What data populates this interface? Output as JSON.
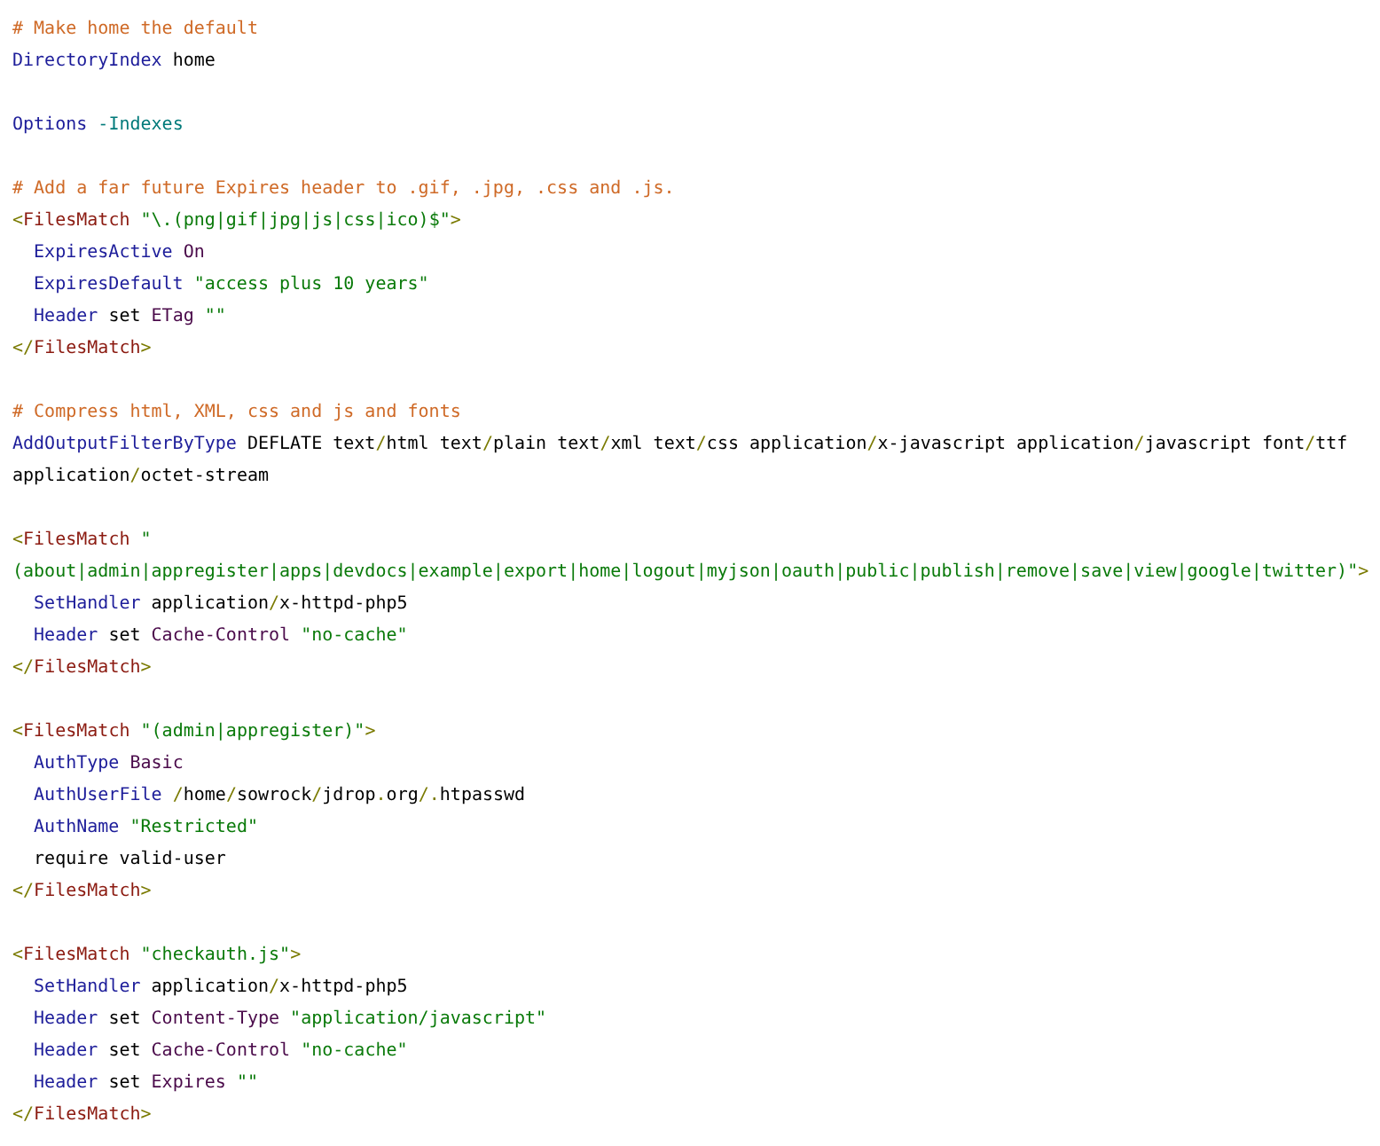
{
  "code_blocks": [
    {
      "lines": [
        [
          {
            "text": "# Make home the default",
            "kind": "comment"
          }
        ],
        [
          {
            "text": "DirectoryIndex",
            "kind": "directive"
          },
          {
            "text": " home",
            "kind": "plain"
          }
        ]
      ]
    },
    {
      "lines": [
        [
          {
            "text": "Options",
            "kind": "directive"
          },
          {
            "text": " -Indexes",
            "kind": "value"
          }
        ]
      ]
    },
    {
      "lines": [
        [
          {
            "text": "# Add a far future Expires header to .gif, .jpg, .css and .js.",
            "kind": "comment"
          }
        ],
        [
          {
            "text": "<",
            "kind": "punct"
          },
          {
            "text": "FilesMatch",
            "kind": "tag"
          },
          {
            "text": " \"\\.(png|gif|jpg|js|css|ico)$\"",
            "kind": "string"
          },
          {
            "text": ">",
            "kind": "punct"
          }
        ],
        [
          {
            "text": "  ExpiresActive",
            "kind": "directive"
          },
          {
            "text": " On",
            "kind": "attr"
          }
        ],
        [
          {
            "text": "  ExpiresDefault",
            "kind": "directive"
          },
          {
            "text": " \"access plus 10 years\"",
            "kind": "string"
          }
        ],
        [
          {
            "text": "  Header",
            "kind": "directive"
          },
          {
            "text": " set ",
            "kind": "plain"
          },
          {
            "text": "ETag",
            "kind": "attr"
          },
          {
            "text": " \"\"",
            "kind": "string"
          }
        ],
        [
          {
            "text": "</",
            "kind": "punct"
          },
          {
            "text": "FilesMatch",
            "kind": "tag"
          },
          {
            "text": ">",
            "kind": "punct"
          }
        ]
      ]
    },
    {
      "lines": [
        [
          {
            "text": "# Compress html, XML, css and js and fonts",
            "kind": "comment"
          }
        ],
        [
          {
            "text": "AddOutputFilterByType",
            "kind": "directive"
          },
          {
            "text": " DEFLATE text",
            "kind": "plain"
          },
          {
            "text": "/",
            "kind": "punct"
          },
          {
            "text": "html text",
            "kind": "plain"
          },
          {
            "text": "/",
            "kind": "punct"
          },
          {
            "text": "plain text",
            "kind": "plain"
          },
          {
            "text": "/",
            "kind": "punct"
          },
          {
            "text": "xml text",
            "kind": "plain"
          },
          {
            "text": "/",
            "kind": "punct"
          },
          {
            "text": "css application",
            "kind": "plain"
          },
          {
            "text": "/",
            "kind": "punct"
          },
          {
            "text": "x-javascript application",
            "kind": "plain"
          },
          {
            "text": "/",
            "kind": "punct"
          },
          {
            "text": "javascript font",
            "kind": "plain"
          },
          {
            "text": "/",
            "kind": "punct"
          },
          {
            "text": "ttf",
            "kind": "plain"
          }
        ],
        [
          {
            "text": "application",
            "kind": "plain"
          },
          {
            "text": "/",
            "kind": "punct"
          },
          {
            "text": "octet-stream",
            "kind": "plain"
          }
        ]
      ]
    },
    {
      "lines": [
        [
          {
            "text": "<",
            "kind": "punct"
          },
          {
            "text": "FilesMatch",
            "kind": "tag"
          },
          {
            "text": " \"",
            "kind": "string"
          }
        ],
        [
          {
            "text": "(about|admin|appregister|apps|devdocs|example|export|home|logout|myjson|oauth|public|publish|remove|save|view|google|twitter)\"",
            "kind": "string"
          },
          {
            "text": ">",
            "kind": "punct"
          }
        ],
        [
          {
            "text": "  SetHandler",
            "kind": "directive"
          },
          {
            "text": " application",
            "kind": "plain"
          },
          {
            "text": "/",
            "kind": "punct"
          },
          {
            "text": "x-httpd-php5",
            "kind": "plain"
          }
        ],
        [
          {
            "text": "  Header",
            "kind": "directive"
          },
          {
            "text": " set ",
            "kind": "plain"
          },
          {
            "text": "Cache-Control",
            "kind": "attr"
          },
          {
            "text": " \"no-cache\"",
            "kind": "string"
          }
        ],
        [
          {
            "text": "</",
            "kind": "punct"
          },
          {
            "text": "FilesMatch",
            "kind": "tag"
          },
          {
            "text": ">",
            "kind": "punct"
          }
        ]
      ]
    },
    {
      "lines": [
        [
          {
            "text": "<",
            "kind": "punct"
          },
          {
            "text": "FilesMatch",
            "kind": "tag"
          },
          {
            "text": " \"(admin|appregister)\"",
            "kind": "string"
          },
          {
            "text": ">",
            "kind": "punct"
          }
        ],
        [
          {
            "text": "  AuthType",
            "kind": "directive"
          },
          {
            "text": " Basic",
            "kind": "attr"
          }
        ],
        [
          {
            "text": "  AuthUserFile",
            "kind": "directive"
          },
          {
            "text": " /",
            "kind": "punct"
          },
          {
            "text": "home",
            "kind": "plain"
          },
          {
            "text": "/",
            "kind": "punct"
          },
          {
            "text": "sowrock",
            "kind": "plain"
          },
          {
            "text": "/",
            "kind": "punct"
          },
          {
            "text": "jdrop",
            "kind": "plain"
          },
          {
            "text": ".",
            "kind": "punct"
          },
          {
            "text": "org",
            "kind": "plain"
          },
          {
            "text": "/.",
            "kind": "punct"
          },
          {
            "text": "htpasswd",
            "kind": "plain"
          }
        ],
        [
          {
            "text": "  AuthName",
            "kind": "directive"
          },
          {
            "text": " \"Restricted\"",
            "kind": "string"
          }
        ],
        [
          {
            "text": "  require valid-user",
            "kind": "plain"
          }
        ],
        [
          {
            "text": "</",
            "kind": "punct"
          },
          {
            "text": "FilesMatch",
            "kind": "tag"
          },
          {
            "text": ">",
            "kind": "punct"
          }
        ]
      ]
    },
    {
      "lines": [
        [
          {
            "text": "<",
            "kind": "punct"
          },
          {
            "text": "FilesMatch",
            "kind": "tag"
          },
          {
            "text": " \"checkauth.js\"",
            "kind": "string"
          },
          {
            "text": ">",
            "kind": "punct"
          }
        ],
        [
          {
            "text": "  SetHandler",
            "kind": "directive"
          },
          {
            "text": " application",
            "kind": "plain"
          },
          {
            "text": "/",
            "kind": "punct"
          },
          {
            "text": "x-httpd-php5",
            "kind": "plain"
          }
        ],
        [
          {
            "text": "  Header",
            "kind": "directive"
          },
          {
            "text": " set ",
            "kind": "plain"
          },
          {
            "text": "Content-Type",
            "kind": "attr"
          },
          {
            "text": " \"application/javascript\"",
            "kind": "string"
          }
        ],
        [
          {
            "text": "  Header",
            "kind": "directive"
          },
          {
            "text": " set ",
            "kind": "plain"
          },
          {
            "text": "Cache-Control",
            "kind": "attr"
          },
          {
            "text": " \"no-cache\"",
            "kind": "string"
          }
        ],
        [
          {
            "text": "  Header",
            "kind": "directive"
          },
          {
            "text": " set ",
            "kind": "plain"
          },
          {
            "text": "Expires",
            "kind": "attr"
          },
          {
            "text": " \"\"",
            "kind": "string"
          }
        ],
        [
          {
            "text": "</",
            "kind": "punct"
          },
          {
            "text": "FilesMatch",
            "kind": "tag"
          },
          {
            "text": ">",
            "kind": "punct"
          }
        ]
      ]
    }
  ]
}
